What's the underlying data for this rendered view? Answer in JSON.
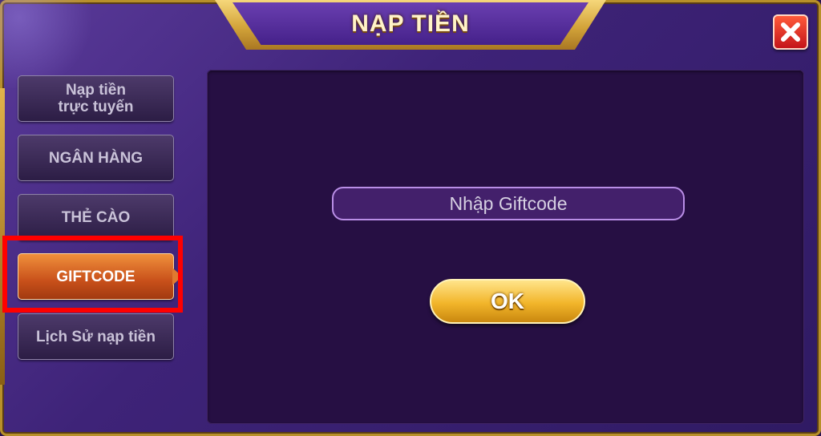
{
  "dialog": {
    "title": "NẠP TIỀN",
    "close_symbol": "✕"
  },
  "sidebar": {
    "items": [
      {
        "label_line1": "Nạp tiền",
        "label_line2": "trực tuyến"
      },
      {
        "label": "NGÂN HÀNG"
      },
      {
        "label": "THẺ CÀO"
      },
      {
        "label": "GIFTCODE",
        "active": true
      },
      {
        "label": "Lịch Sử nạp tiền"
      }
    ]
  },
  "giftcode": {
    "placeholder": "Nhập Giftcode",
    "ok_label": "OK"
  },
  "colors": {
    "accent_gold": "#f2b52a",
    "active_orange": "#e07a30",
    "panel_purple": "#260f43",
    "highlight_red": "#ff0000"
  }
}
